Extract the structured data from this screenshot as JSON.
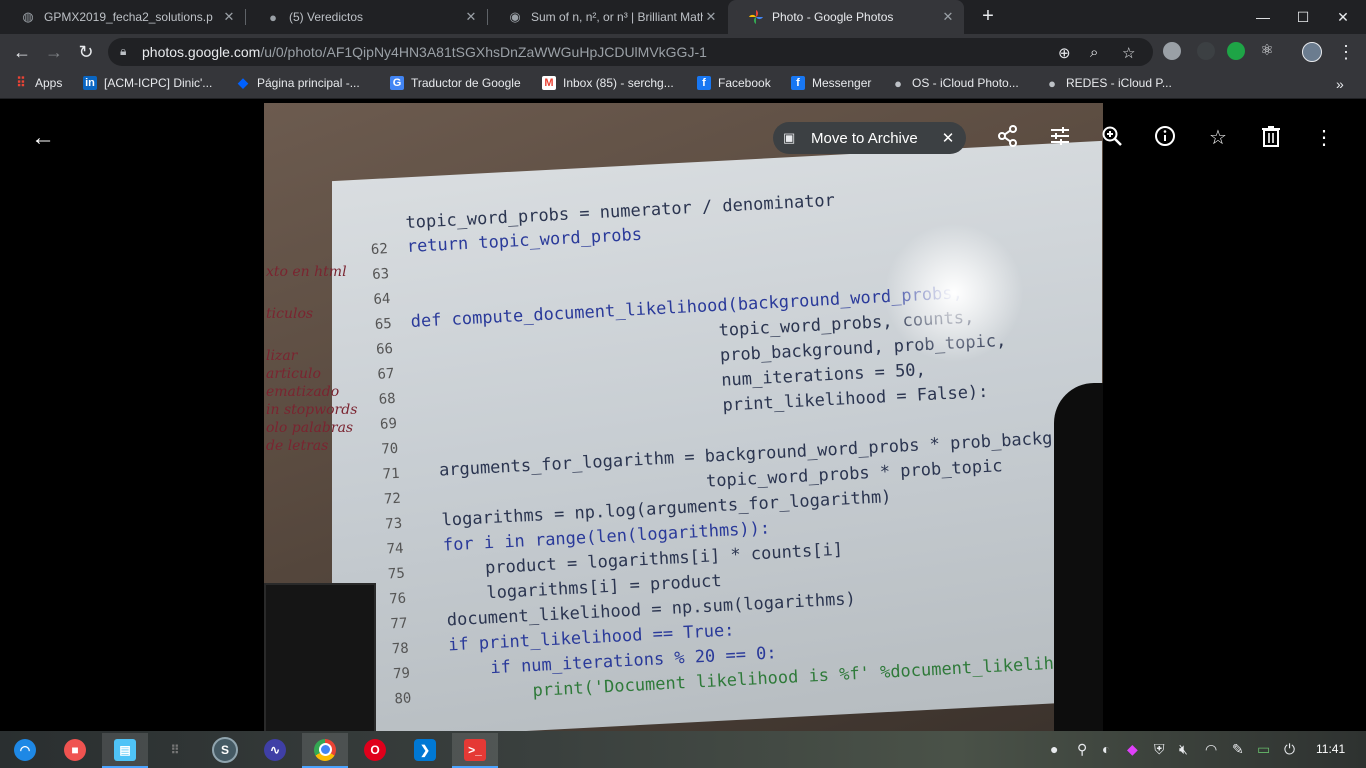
{
  "browser": {
    "tabs": [
      {
        "title": "GPMX2019_fecha2_solutions.p",
        "icon": "globe-icon"
      },
      {
        "title": "(5) Veredictos",
        "icon": "github-icon"
      },
      {
        "title": "Sum of n, n², or n³ | Brilliant Math",
        "icon": "brilliant-icon"
      },
      {
        "title": "Photo - Google Photos",
        "icon": "google-photos-icon"
      }
    ],
    "url_host": "photos.google.com",
    "url_path": "/u/0/photo/AF1QipNy4HN3A81tSGXhsDnZaWWGuHpJCDUlMVkGGJ-1"
  },
  "bookmarks": [
    {
      "label": "Apps",
      "icon": "apps-grid-icon"
    },
    {
      "label": "[ACM-ICPC] Dinic'...",
      "icon": "linkedin-icon"
    },
    {
      "label": "Página principal -...",
      "icon": "dropbox-icon"
    },
    {
      "label": "Traductor de Google",
      "icon": "google-translate-icon"
    },
    {
      "label": "Inbox (85) - serchg...",
      "icon": "gmail-icon"
    },
    {
      "label": "Facebook",
      "icon": "facebook-icon"
    },
    {
      "label": "Messenger",
      "icon": "facebook-icon"
    },
    {
      "label": "OS - iCloud Photo...",
      "icon": "apple-icon"
    },
    {
      "label": "REDES - iCloud P...",
      "icon": "apple-icon"
    }
  ],
  "viewer": {
    "archive_label": "Move to Archive"
  },
  "photo": {
    "code_lines": [
      {
        "n": "",
        "text": "topic_word_probs = numerator / denominator"
      },
      {
        "n": "62",
        "text": "return topic_word_probs"
      },
      {
        "n": "63",
        "text": ""
      },
      {
        "n": "64",
        "text": ""
      },
      {
        "n": "65",
        "text": "def compute_document_likelihood(background_word_probs,"
      },
      {
        "n": "66",
        "text": "                              topic_word_probs, counts,"
      },
      {
        "n": "67",
        "text": "                              prob_background, prob_topic,"
      },
      {
        "n": "68",
        "text": "                              num_iterations = 50,"
      },
      {
        "n": "69",
        "text": "                              print_likelihood = False):"
      },
      {
        "n": "70",
        "text": ""
      },
      {
        "n": "71",
        "text": "  arguments_for_logarithm = background_word_probs * prob_background + \\"
      },
      {
        "n": "72",
        "text": "                            topic_word_probs * prob_topic"
      },
      {
        "n": "73",
        "text": "  logarithms = np.log(arguments_for_logarithm)"
      },
      {
        "n": "74",
        "text": "  for i in range(len(logarithms)):"
      },
      {
        "n": "75",
        "text": "      product = logarithms[i] * counts[i]"
      },
      {
        "n": "76",
        "text": "      logarithms[i] = product"
      },
      {
        "n": "77",
        "text": "  document_likelihood = np.sum(logarithms)"
      },
      {
        "n": "78",
        "text": "  if print_likelihood == True:"
      },
      {
        "n": "79",
        "text": "      if num_iterations % 20 == 0:"
      },
      {
        "n": "80",
        "text": "          print('Document likelihood is %f' %document_likelihood)"
      }
    ],
    "margin_notes": [
      "xto en html",
      "ticulos",
      "lizar",
      "articulo",
      "ematizado",
      "in stopwords",
      "olo palabras",
      "de letras"
    ]
  },
  "taskbar": {
    "clock": "11:41",
    "apps": [
      "deepin-icon",
      "screen-recorder-icon",
      "file-manager-icon",
      "launcher-icon",
      "sublime-icon",
      "system-monitor-icon",
      "chrome-icon",
      "opera-icon",
      "vscode-icon",
      "terminal-icon"
    ]
  },
  "colors": {
    "tabbar_bg": "#202124",
    "toolbar_bg": "#35363a",
    "viewer_bg": "#000000",
    "chip_bg": "#3c4043"
  }
}
